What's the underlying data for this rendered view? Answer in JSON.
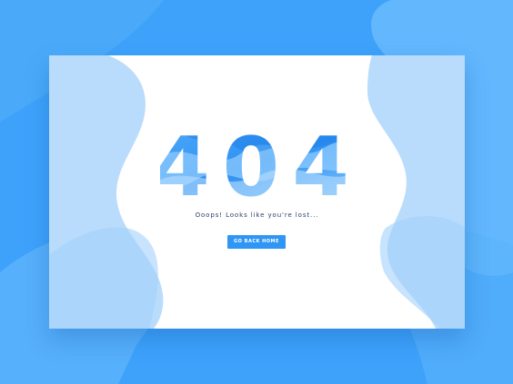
{
  "error": {
    "code": "404",
    "message": "Ooops! Looks like you're lost...",
    "button_label": "GO BACK HOME"
  },
  "colors": {
    "background": "#3ea2fb",
    "card": "#ffffff",
    "accent": "#2f96f5",
    "light_blob": "#bfe0fc",
    "text": "#27416b"
  }
}
